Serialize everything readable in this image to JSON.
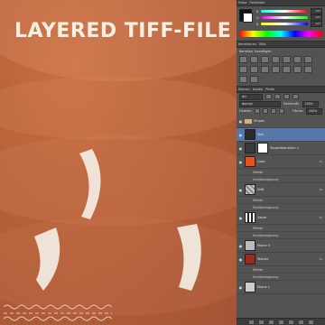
{
  "canvas": {
    "title": "LAYERED TIFF-FILE",
    "colors": {
      "background": "#b45f38",
      "accent_white": "#f3ece2"
    }
  },
  "panels": {
    "color": {
      "tabs": [
        "Farbe",
        "Farbfelder"
      ],
      "sliders": [
        {
          "label": "R",
          "value": "127"
        },
        {
          "label": "G",
          "value": "127"
        },
        {
          "label": "B",
          "value": "127"
        }
      ]
    },
    "adjustments": {
      "tabs": [
        "Korrekturen",
        "Stile"
      ],
      "heading": "Korrektur hinzufügen"
    },
    "layers": {
      "tabs": [
        "Ebenen",
        "Kanäle",
        "Pfade"
      ],
      "filter_value": "Art",
      "blend_mode": "Normal",
      "opacity_label": "Deckkraft:",
      "opacity_value": "100%",
      "lock_label": "Fixieren:",
      "fill_label": "Fläche:",
      "fill_value": "100%",
      "items": [
        {
          "name": "Stripes",
          "kind": "group"
        },
        {
          "name": "Text",
          "kind": "layer",
          "selected": true
        },
        {
          "name": "Tonwertkorrektur 1",
          "kind": "adjustment"
        },
        {
          "name": "Color",
          "kind": "layer",
          "thumb": "#e8501c",
          "effects": [
            "Effekte",
            "Farbüberlagerung"
          ]
        },
        {
          "name": "Drift",
          "kind": "layer",
          "effects": [
            "Effekte",
            "Farbüberlagerung"
          ]
        },
        {
          "name": "Zacke",
          "kind": "layer",
          "effects": [
            "Effekte",
            "Farbüberlagerung"
          ]
        },
        {
          "name": "Ebene 4",
          "kind": "layer"
        },
        {
          "name": "Texture",
          "kind": "layer",
          "thumb": "#9a2a1e",
          "effects": [
            "Effekte",
            "Farbüberlagerung"
          ]
        },
        {
          "name": "Ebene 1",
          "kind": "layer"
        }
      ]
    }
  }
}
